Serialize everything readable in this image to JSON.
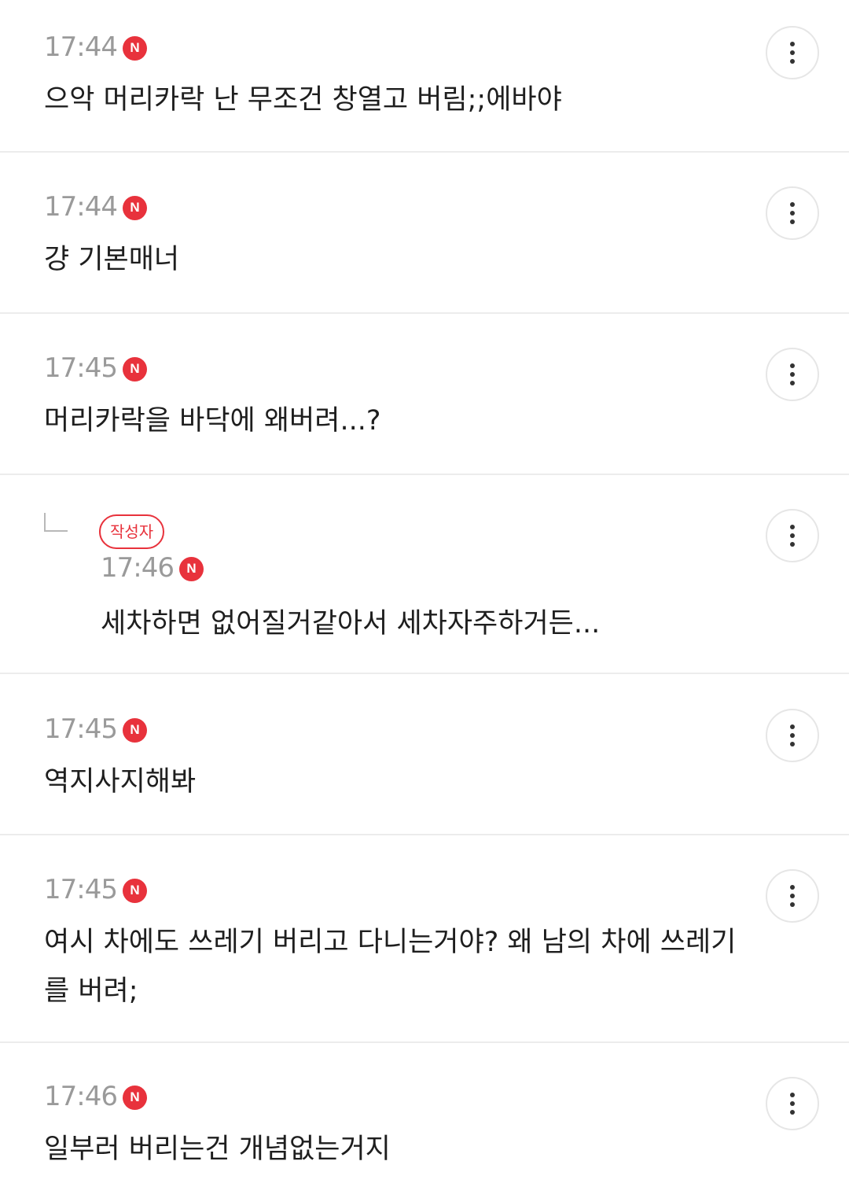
{
  "comments": [
    {
      "time": "17:44",
      "new_badge": "N",
      "text": "으악 머리카락 난 무조건 창열고 버림;;에바야",
      "more_icon": "more-vertical-icon"
    },
    {
      "time": "17:44",
      "new_badge": "N",
      "text": "걍 기본매너",
      "more_icon": "more-vertical-icon"
    },
    {
      "time": "17:45",
      "new_badge": "N",
      "text": "머리카락을 바닥에 왜버려...?",
      "more_icon": "more-vertical-icon"
    },
    {
      "is_reply": true,
      "author_badge": "작성자",
      "time": "17:46",
      "new_badge": "N",
      "text": "세차하면 없어질거같아서 세차자주하거든...",
      "more_icon": "more-vertical-icon"
    },
    {
      "time": "17:45",
      "new_badge": "N",
      "text": "역지사지해봐",
      "more_icon": "more-vertical-icon"
    },
    {
      "time": "17:45",
      "new_badge": "N",
      "text": "여시 차에도 쓰레기 버리고 다니는거야? 왜 남의 차에 쓰레기를 버려;",
      "more_icon": "more-vertical-icon"
    },
    {
      "time": "17:46",
      "new_badge": "N",
      "text": "일부러 버리는건 개념없는거지",
      "more_icon": "more-vertical-icon"
    }
  ],
  "colors": {
    "new_badge": "#e8323c",
    "author_badge": "#e8323c",
    "time": "#9a9a9a",
    "text": "#1e1e1e",
    "divider": "#ececec"
  }
}
